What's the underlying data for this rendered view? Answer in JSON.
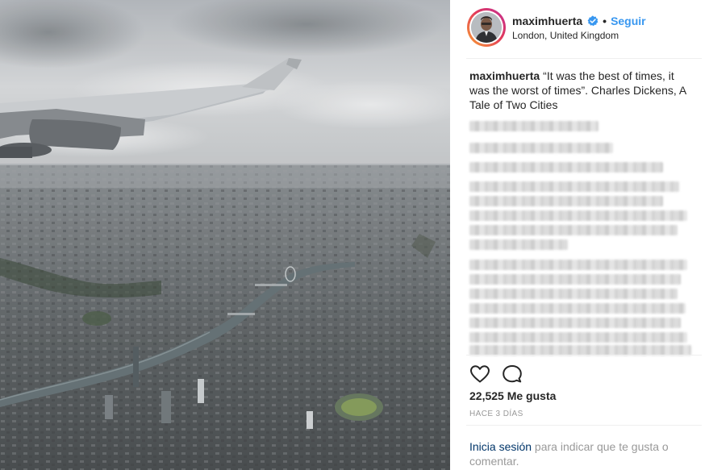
{
  "post": {
    "username": "maximhuerta",
    "follow_label": "Seguir",
    "separator": "•",
    "location": "London, United Kingdom",
    "caption": "“It was the best of times, it was the worst of times”. Charles Dickens, A Tale of Two Cities",
    "likes_text": "22,525 Me gusta",
    "time_ago": "HACE 3 DÍAS",
    "login_link": "Inicia sesión",
    "login_suffix": " para indicar que te gusta o comentar."
  },
  "icons": {
    "verified": "verified-badge-icon",
    "like": "heart-icon",
    "comment": "comment-icon"
  },
  "colors": {
    "accent": "#3897f0",
    "link": "#003569",
    "verified": "#3897f0",
    "muted": "#999999"
  }
}
